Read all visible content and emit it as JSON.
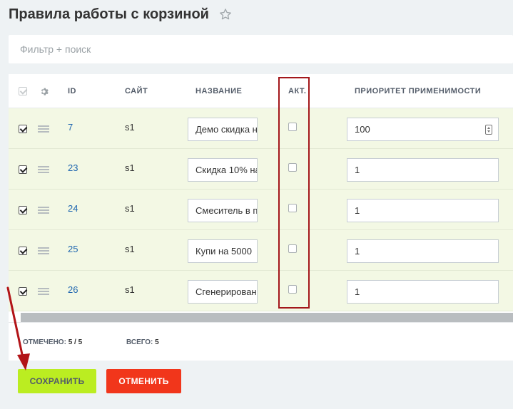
{
  "page": {
    "title": "Правила работы с корзиной"
  },
  "filter": {
    "placeholder": "Фильтр + поиск"
  },
  "grid": {
    "columns": {
      "id": "ID",
      "site": "САЙТ",
      "name": "НАЗВАНИЕ",
      "active": "АКТ.",
      "priority": "ПРИОРИТЕТ ПРИМЕНИМОСТИ"
    },
    "rows": [
      {
        "selected": true,
        "id": "7",
        "site": "s1",
        "name": "Демо скидка на",
        "active": false,
        "priority": "100"
      },
      {
        "selected": true,
        "id": "23",
        "site": "s1",
        "name": "Скидка 10% на",
        "active": false,
        "priority": "1"
      },
      {
        "selected": true,
        "id": "24",
        "site": "s1",
        "name": "Смеситель в по",
        "active": false,
        "priority": "1"
      },
      {
        "selected": true,
        "id": "25",
        "site": "s1",
        "name": "Купи на 5000",
        "active": false,
        "priority": "1"
      },
      {
        "selected": true,
        "id": "26",
        "site": "s1",
        "name": "Сгенерировано",
        "active": false,
        "priority": "1"
      }
    ]
  },
  "footer": {
    "selected_label": "ОТМЕЧЕНО:",
    "selected_value": "5 / 5",
    "total_label": "ВСЕГО:",
    "total_value": "5"
  },
  "buttons": {
    "save": "СОХРАНИТЬ",
    "cancel": "ОТМЕНИТЬ"
  },
  "icons": {
    "star": "star-icon",
    "settings": "gear-icon",
    "drag": "drag-handle-icon",
    "arrow": "arrow-annotation"
  },
  "colors": {
    "save": "#bbed21",
    "cancel": "#f1361b",
    "highlight": "#a3171b",
    "row_bg": "#f3f8e4",
    "link": "#2067b0"
  }
}
